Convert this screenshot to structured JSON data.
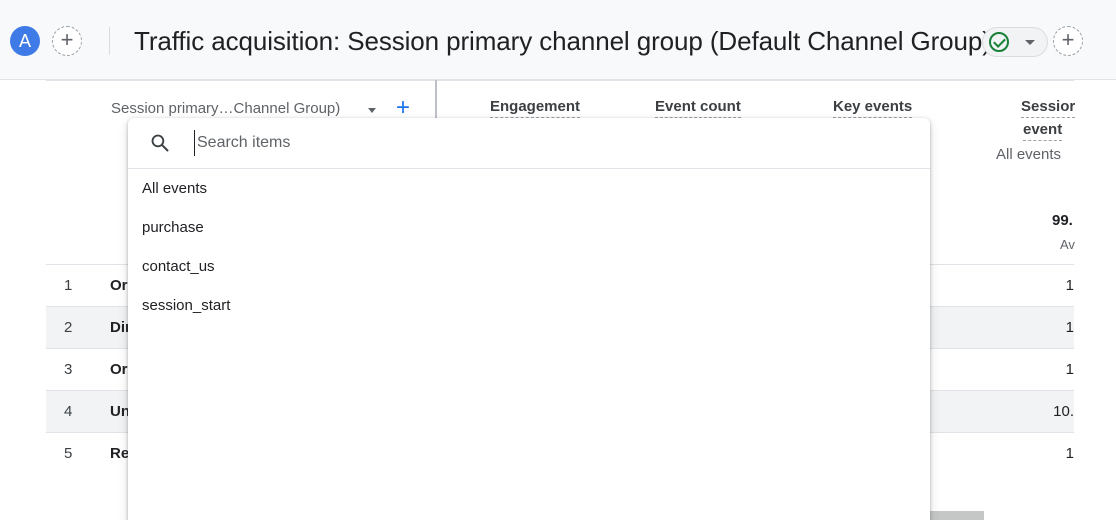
{
  "header": {
    "avatar_letter": "A",
    "add_label": "+",
    "title": "Traffic acquisition: Session primary channel group (Default Channel Group)"
  },
  "table": {
    "dimension_header": "Session primary…Channel Group)",
    "add_dimension": "+",
    "metrics": {
      "engagement": "Engagement",
      "event_count": "Event count",
      "key_events": "Key events",
      "session_events_line1": "Sessior",
      "session_events_line2": "event"
    },
    "event_filter": "All events",
    "total_value": "99.",
    "total_sub": "Av",
    "rows": [
      {
        "index": "1",
        "name": "Or",
        "value": "1"
      },
      {
        "index": "2",
        "name": "Dir",
        "value": "1"
      },
      {
        "index": "3",
        "name": "Or",
        "value": "1"
      },
      {
        "index": "4",
        "name": "Un",
        "value": "10."
      },
      {
        "index": "5",
        "name": "Re",
        "value": "1"
      }
    ]
  },
  "dropdown": {
    "search_placeholder": "Search items",
    "items": [
      "All events",
      "purchase",
      "contact_us",
      "session_start"
    ]
  },
  "colors": {
    "accent": "#1a73e8",
    "avatar": "#3f7be6",
    "status_ok": "#188038"
  }
}
